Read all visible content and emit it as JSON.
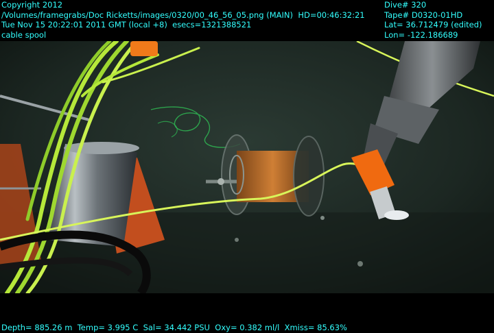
{
  "overlay": {
    "top_left": [
      "Copyright 2012",
      "/Volumes/framegrabs/Doc Ricketts/images/0320/00_46_56_05.png (MAIN)  HD=00:46:32:21",
      "Tue Nov 15 20:22:01 2011 GMT (local +8)  esecs=1321388521",
      "cable spool"
    ],
    "top_right": [
      "Dive# 320",
      "Tape# D0320-01HD",
      "Lat= 36.712479 (edited)",
      "Lon= -122.186689"
    ],
    "bottom": "Depth= 885.26 m  Temp= 3.995 C  Sal= 34.442 PSU  Oxy= 0.382 ml/l  Xmiss= 85.63%"
  },
  "colors": {
    "overlay_text": "#33ffff",
    "seafloor": "#1f2a24",
    "cable_yellow": "#d8f55a",
    "cable_green": "#9be33a",
    "spool_orange": "#c8782c",
    "gripper_orange": "#f06a10"
  }
}
